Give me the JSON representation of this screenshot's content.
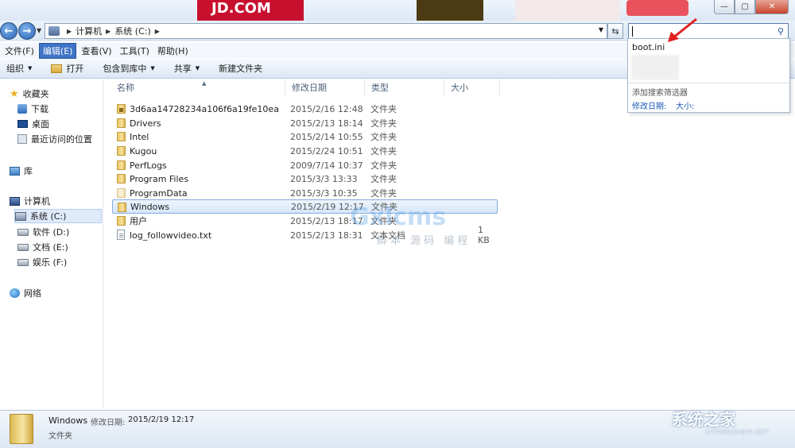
{
  "window": {
    "controls": {
      "minimize": "—",
      "maximize": "▢",
      "close": "✕"
    }
  },
  "banner": {
    "jd_text": "JD.COM"
  },
  "nav": {
    "breadcrumb": [
      "计算机",
      "系统 (C:)"
    ],
    "search_value": ""
  },
  "menu": [
    {
      "label": "文件(F)",
      "active": false
    },
    {
      "label": "编辑(E)",
      "active": true
    },
    {
      "label": "查看(V)",
      "active": false
    },
    {
      "label": "工具(T)",
      "active": false
    },
    {
      "label": "帮助(H)",
      "active": false
    }
  ],
  "toolbar": {
    "organize": "组织",
    "open": "打开",
    "include_library": "包含到库中",
    "share": "共享",
    "new_folder": "新建文件夹"
  },
  "sidebar": {
    "favorites": "收藏夹",
    "downloads": "下载",
    "desktop": "桌面",
    "recent": "最近访问的位置",
    "libraries": "库",
    "computer": "计算机",
    "drive_c": "系统 (C:)",
    "drive_d": "软件 (D:)",
    "drive_e": "文档 (E:)",
    "drive_f": "娱乐 (F:)",
    "network": "网络"
  },
  "columns": {
    "name": "名称",
    "date": "修改日期",
    "type": "类型",
    "size": "大小"
  },
  "files": [
    {
      "name": "3d6aa14728234a106f6a19fe10ea",
      "date": "2015/2/16 12:48",
      "type": "文件夹",
      "size": ""
    },
    {
      "name": "Drivers",
      "date": "2015/2/13 18:14",
      "type": "文件夹",
      "size": ""
    },
    {
      "name": "Intel",
      "date": "2015/2/14 10:55",
      "type": "文件夹",
      "size": ""
    },
    {
      "name": "Kugou",
      "date": "2015/2/24 10:51",
      "type": "文件夹",
      "size": ""
    },
    {
      "name": "PerfLogs",
      "date": "2009/7/14 10:37",
      "type": "文件夹",
      "size": ""
    },
    {
      "name": "Program Files",
      "date": "2015/3/3 13:33",
      "type": "文件夹",
      "size": ""
    },
    {
      "name": "ProgramData",
      "date": "2015/3/3 10:35",
      "type": "文件夹",
      "size": ""
    },
    {
      "name": "Windows",
      "date": "2015/2/19 12:17",
      "type": "文件夹",
      "size": ""
    },
    {
      "name": "用户",
      "date": "2015/2/13 18:17",
      "type": "文件夹",
      "size": ""
    },
    {
      "name": "log_followvideo.txt",
      "date": "2015/2/13 18:31",
      "type": "文本文档",
      "size": "1 KB"
    }
  ],
  "search_popup": {
    "recent_item": "boot.ini",
    "add_filter": "添加搜索筛选器",
    "filter_date": "修改日期:",
    "filter_size": "大小:"
  },
  "details": {
    "name": "Windows",
    "date_label": "修改日期:",
    "date_value": "2015/2/19 12:17",
    "type": "文件夹"
  },
  "watermark": {
    "main": "Gxlcms",
    "sub": "脚本 源码 编程"
  },
  "logo": {
    "main": "系统之家",
    "sub": "XITONGZHIJIA.NET"
  },
  "colors": {
    "accent": "#3f73c5",
    "selection": "#d7e6f9",
    "link": "#1c59b5",
    "arrow": "#e02020"
  }
}
